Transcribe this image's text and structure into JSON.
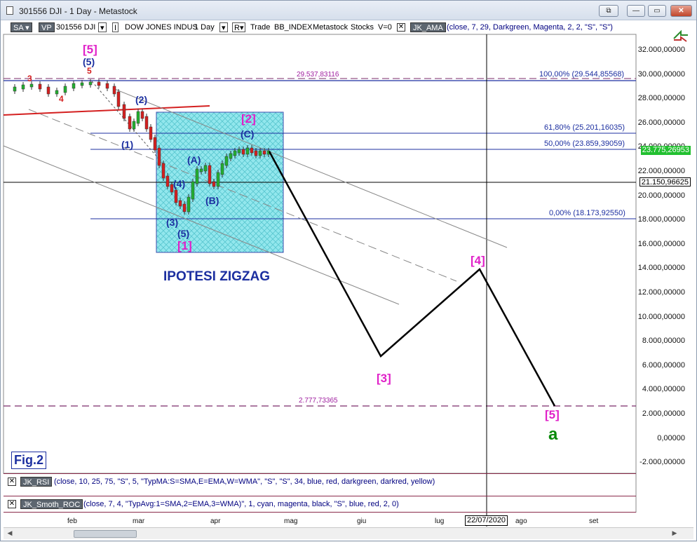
{
  "window": {
    "title": "301556 DJI - 1 Day - Metastock",
    "buttons": {
      "restore": "⧉",
      "minimize": "—",
      "maximize": "▭",
      "close": "✕"
    }
  },
  "toolbar": {
    "sa": "SA",
    "vp": "VP",
    "symbol": "301556 DJI",
    "instrument": "DOW JONES INDUS",
    "period": "1 Day",
    "trade_label": "Trade",
    "indicator_name": "BB_INDEX",
    "source": "Metastock",
    "stocks": "Stocks",
    "v": "V=0",
    "ama_name": "JK_AMA",
    "ama_params": "(close, 7, 29, Darkgreen, Magenta, 2, 2, \"S\", \"S\")"
  },
  "price_axis": {
    "labels": [
      "32.000,00000",
      "30.000,00000",
      "28.000,00000",
      "26.000,00000",
      "24.000,00000",
      "22.000,00000",
      "20.000,00000",
      "18.000,00000",
      "16.000,00000",
      "14.000,00000",
      "12.000,00000",
      "10.000,00000",
      "8.000,00000",
      "6.000,00000",
      "4.000,00000",
      "2.000,00000",
      "0,00000",
      "-2.000,00000"
    ],
    "current_price": "23.775,26953",
    "cursor_price": "21.150,96625"
  },
  "x_axis": {
    "labels": [
      "feb",
      "mar",
      "apr",
      "mag",
      "giu",
      "lug",
      "ago",
      "set"
    ],
    "cursor_date": "22/07/2020"
  },
  "fib_levels": {
    "level_100": "100,00% (29.544,85568)",
    "level_618": "61,80% (25.201,16035)",
    "level_50": "50,00% (23.859,39059)",
    "level_0": "0,00% (18.173,92550)",
    "top_line": "29.537,83116",
    "bottom_line": "2.777,73365"
  },
  "annotations": {
    "wave5_big": "[5]",
    "wave5_small": "(5)",
    "w5_red": "5",
    "w3_red": "3",
    "w4_red": "4",
    "w2": "(2)",
    "w1": "(1)",
    "w2_bracket": "[2]",
    "wC": "(C)",
    "wA": "(A)",
    "w4": "(4)",
    "wB": "(B)",
    "w3": "(3)",
    "w5": "(5)",
    "w1_bracket": "[1]",
    "w3_bracket": "[3]",
    "w4_bracket": "[4]",
    "w5_bracket": "[5]",
    "a": "a",
    "ipotesi": "IPOTESI ZIGZAG",
    "fig": "Fig.2"
  },
  "subpanels": {
    "rsi_name": "JK_RSI",
    "rsi_params": "(close, 10, 25, 75, \"S\", 5, \"TypMA:S=SMA,E=EMA,W=WMA\", \"S\", \"S\", 34, blue, red, darkgreen, darkred, yellow)",
    "roc_name": "JK_Smoth_ROC",
    "roc_params": "(close, 7, 4, \"TypAvg:1=SMA,2=EMA,3=WMA)\", 1, cyan, magenta, black, \"S\", blue, red, 2, 0)"
  },
  "colors": {
    "projection": "#000000",
    "fib_line": "#1c2fa0",
    "magenta": "#e020c8",
    "blue_label": "#1c2fa0",
    "red": "#d42020",
    "box_fill": "#5fd7e0",
    "green": "#0a8a0a",
    "dashed_purple": "#7a2a6a"
  }
}
